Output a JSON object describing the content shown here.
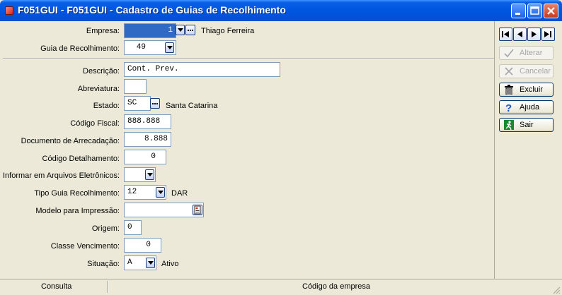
{
  "window": {
    "title": "F051GUI - F051GUI - Cadastro de Guias de Recolhimento"
  },
  "form": {
    "empresa": {
      "label": "Empresa:",
      "value": "1",
      "description": "Thiago Ferreira"
    },
    "guia": {
      "label": "Guia de Recolhimento:",
      "value": "49"
    },
    "descricao": {
      "label": "Descrição:",
      "value": "Cont. Prev."
    },
    "abreviatura": {
      "label": "Abreviatura:",
      "value": ""
    },
    "estado": {
      "label": "Estado:",
      "value": "SC",
      "description": "Santa Catarina"
    },
    "codigo_fiscal": {
      "label": "Código  Fiscal:",
      "value": "888.888"
    },
    "documento_arrecadacao": {
      "label": "Documento de Arrecadação:",
      "value": "8.888"
    },
    "codigo_detalhamento": {
      "label": "Código Detalhamento:",
      "value": "0"
    },
    "informar_arquivos": {
      "label": "Informar em Arquivos Eletrônicos:",
      "value": ""
    },
    "tipo_guia": {
      "label": "Tipo Guia Recolhimento:",
      "value": "12",
      "description": "DAR"
    },
    "modelo_impressao": {
      "label": "Modelo para Impressão:",
      "value": ""
    },
    "origem": {
      "label": "Origem:",
      "value": "0"
    },
    "classe_vencimento": {
      "label": "Classe Vencimento:",
      "value": "0"
    },
    "situacao": {
      "label": "Situação:",
      "value": "A",
      "description": "Ativo"
    }
  },
  "actions": {
    "alterar": "Alterar",
    "cancelar": "Cancelar",
    "excluir": "Excluir",
    "ajuda": "Ajuda",
    "sair": "Sair"
  },
  "statusbar": {
    "mode": "Consulta",
    "hint": "Código da empresa"
  },
  "icons": [
    "app-icon",
    "minimize-icon",
    "maximize-icon",
    "close-icon",
    "first-record-icon",
    "previous-record-icon",
    "next-record-icon",
    "last-record-icon",
    "checkmark-icon",
    "cancel-x-icon",
    "trash-icon",
    "help-question-icon",
    "exit-running-man-icon",
    "ellipsis-icon",
    "dropdown-arrow-icon",
    "report-model-icon"
  ],
  "colors": {
    "titlebar": "#0054e3",
    "selection": "#316ac5",
    "window_bg": "#ece9d8"
  }
}
